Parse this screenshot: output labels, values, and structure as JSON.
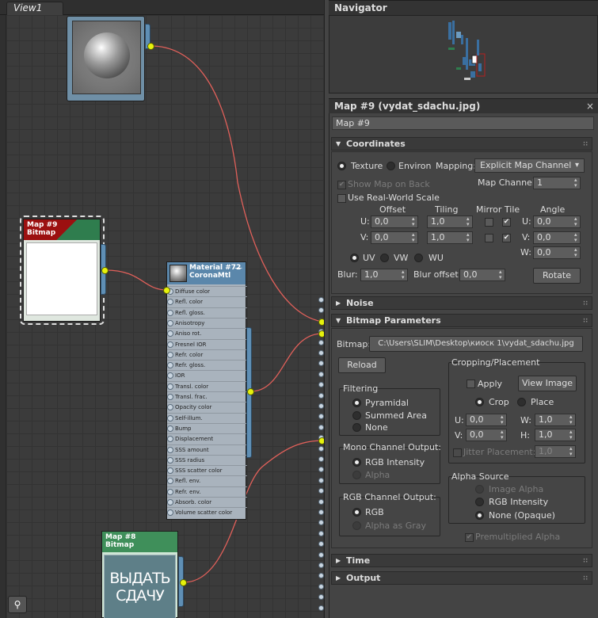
{
  "view": {
    "tab_label": "View1",
    "icon_bottom": "people-icon"
  },
  "nodes": {
    "map9": {
      "title": "Map #9",
      "subtitle": "Bitmap"
    },
    "material": {
      "title": "Material #72",
      "subtitle": "CoronaMtl",
      "minimize": "—",
      "slots": [
        "Diffuse color",
        "Refl. color",
        "Refl. gloss.",
        "Anisotropy",
        "Aniso rot.",
        "Fresnel IOR",
        "Refr. color",
        "Refr. gloss.",
        "IOR",
        "Transl. color",
        "Transl. frac.",
        "Opacity color",
        "Self-illum.",
        "Bump",
        "Displacement",
        "SSS amount",
        "SSS radius",
        "SSS scatter color",
        "Refl. env.",
        "Refr. env.",
        "Absorb. color",
        "Volume scatter color"
      ]
    },
    "map8": {
      "title": "Map #8",
      "subtitle": "Bitmap",
      "thumb_text_1": "ВЫДАТЬ",
      "thumb_text_2": "СДАЧУ"
    }
  },
  "navigator": {
    "title": "Navigator"
  },
  "editor": {
    "title": "Map #9 (vydat_sdachu.jpg)",
    "map_name": "Map #9",
    "coordinates": {
      "header": "Coordinates",
      "texture": "Texture",
      "environ": "Environ",
      "mapping_label": "Mapping:",
      "mapping_value": "Explicit Map Channel",
      "show_map_on_back": "Show Map on Back",
      "map_channel_label": "Map Channel:",
      "map_channel_value": "1",
      "use_real_world": "Use Real-World Scale",
      "offset": "Offset",
      "tiling": "Tiling",
      "mirror_tile": "Mirror Tile",
      "angle": "Angle",
      "u": "U:",
      "v": "V:",
      "w": "W:",
      "u_offset": "0,0",
      "v_offset": "0,0",
      "u_tiling": "1,0",
      "v_tiling": "1,0",
      "u_angle": "0,0",
      "v_angle": "0,0",
      "w_angle": "0,0",
      "uv": "UV",
      "vw": "VW",
      "wu": "WU",
      "blur_label": "Blur:",
      "blur_value": "1,0",
      "blur_offset_label": "Blur offset:",
      "blur_offset_value": "0,0",
      "rotate": "Rotate"
    },
    "noise": {
      "header": "Noise"
    },
    "bitmap": {
      "header": "Bitmap Parameters",
      "bitmap_label": "Bitmap:",
      "bitmap_path": "C:\\Users\\SLIM\\Desktop\\киоск 1\\vydat_sdachu.jpg",
      "reload": "Reload",
      "filtering": "Filtering",
      "pyramidal": "Pyramidal",
      "summed_area": "Summed Area",
      "none": "None",
      "mono_channel": "Mono Channel Output:",
      "rgb_intensity": "RGB Intensity",
      "alpha": "Alpha",
      "rgb_channel": "RGB Channel Output:",
      "rgb": "RGB",
      "alpha_as_gray": "Alpha as Gray",
      "cropping": "Cropping/Placement",
      "apply": "Apply",
      "view_image": "View Image",
      "crop": "Crop",
      "place": "Place",
      "u_label": "U:",
      "v_label": "V:",
      "w_label": "W:",
      "h_label": "H:",
      "u_value": "0,0",
      "v_value": "0,0",
      "w_value": "1,0",
      "h_value": "1,0",
      "jitter": "Jitter Placement:",
      "jitter_value": "1,0",
      "alpha_source": "Alpha Source",
      "image_alpha": "Image Alpha",
      "alpha_rgb_intensity": "RGB Intensity",
      "none_opaque": "None (Opaque)",
      "premultiplied": "Premultiplied Alpha"
    },
    "time": {
      "header": "Time"
    },
    "output": {
      "header": "Output"
    }
  }
}
